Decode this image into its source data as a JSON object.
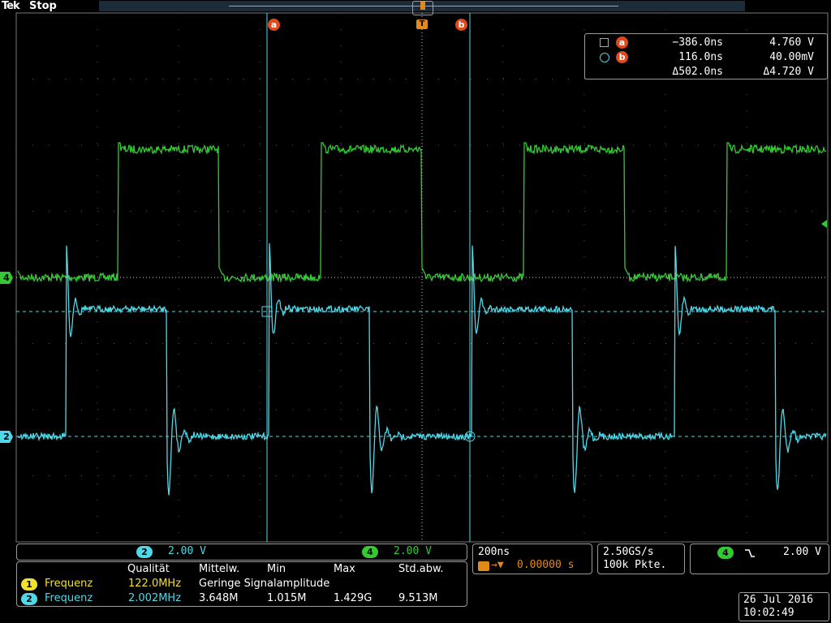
{
  "topbar": {
    "brand": "Tek",
    "status": "Stop"
  },
  "cursor_markers": {
    "a": "a",
    "trigger": "T",
    "b": "b"
  },
  "channel_markers": {
    "ch4": "4",
    "ch2": "2"
  },
  "cursor_readout": {
    "a": {
      "time": "−386.0ns",
      "value": "4.760 V"
    },
    "b": {
      "time": "116.0ns",
      "value": "40.00mV"
    },
    "delta": {
      "time": "Δ502.0ns",
      "value": "Δ4.720 V"
    }
  },
  "channels": {
    "ch2": {
      "num": "2",
      "scale": "2.00 V",
      "color": "#4fd8e8"
    },
    "ch4": {
      "num": "4",
      "scale": "2.00 V",
      "color": "#34c934"
    }
  },
  "timebase": {
    "scale": "200ns",
    "position": "0.00000 s"
  },
  "acquisition": {
    "rate": "2.50GS/s",
    "points": "100k Pkte."
  },
  "trigger": {
    "channel": "4",
    "slope_icon": "falling-edge-icon",
    "level": "2.00 V"
  },
  "measurements": {
    "headers": [
      "Qualität",
      "Mittelw.",
      "Min",
      "Max",
      "Std.abw."
    ],
    "rows": [
      {
        "num": "1",
        "name": "Frequenz",
        "value": "122.0MHz",
        "note": "Geringe Signalamplitude"
      },
      {
        "num": "2",
        "name": "Frequenz",
        "value": "2.002MHz",
        "mean": "3.648M",
        "min": "1.015M",
        "max": "1.429G",
        "std": "9.513M"
      }
    ]
  },
  "datetime": {
    "date": "26 Jul  2016",
    "time": "10:02:49"
  },
  "colors": {
    "ch1": "#f0e030",
    "ch2": "#4fd8e8",
    "ch4": "#34c934",
    "cursor_badge": "#e04a1a",
    "trigger_badge": "#e08a1a"
  }
}
